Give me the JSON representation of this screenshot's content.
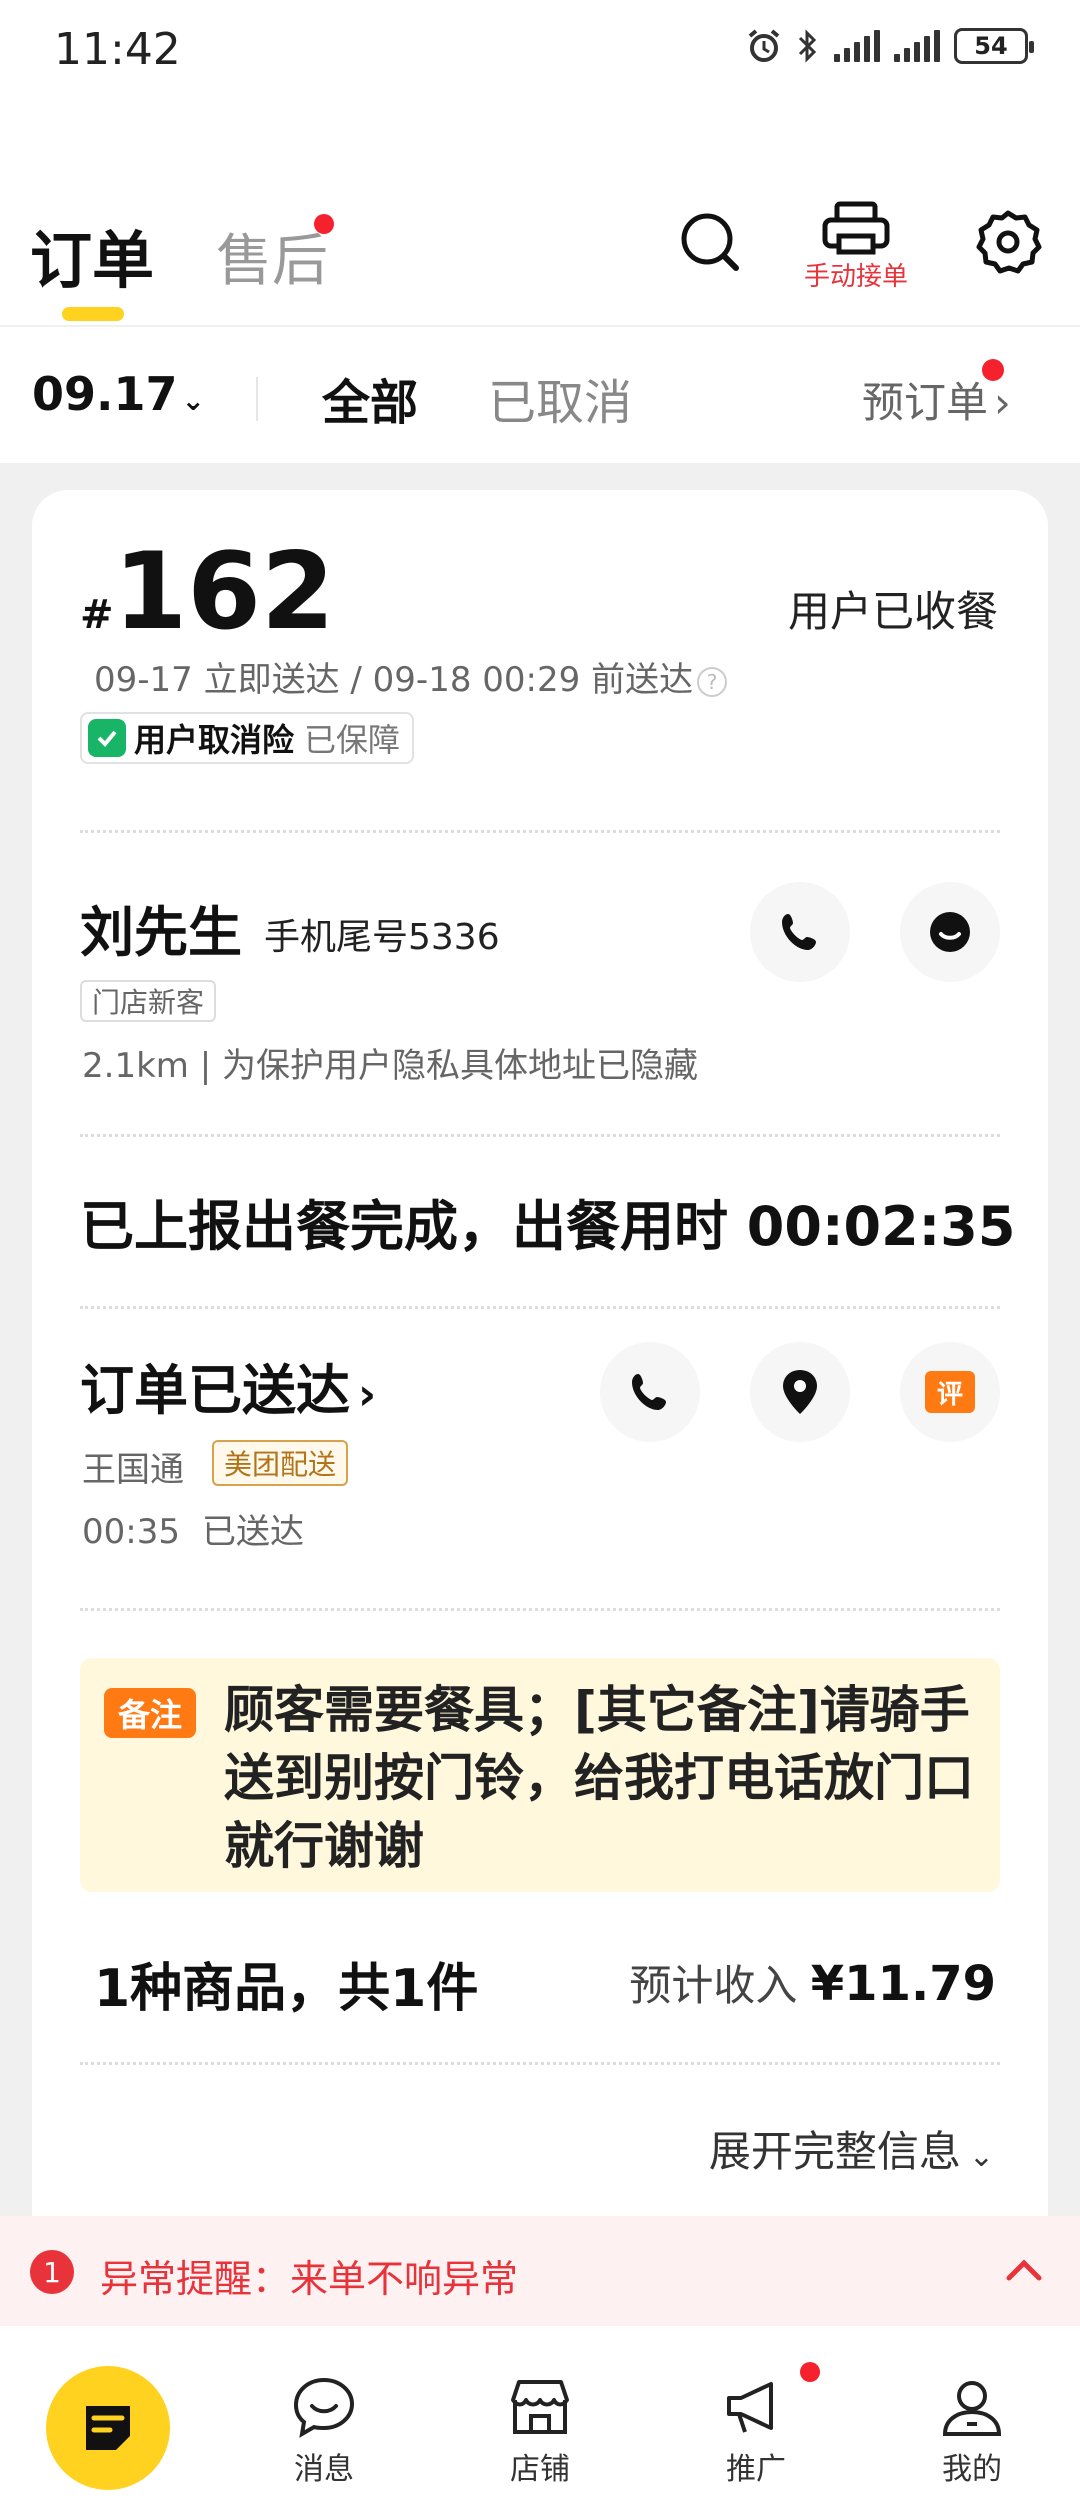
{
  "status_bar": {
    "time": "11:42",
    "battery": "54"
  },
  "header": {
    "tabs": [
      {
        "label": "订单"
      },
      {
        "label": "售后"
      }
    ],
    "manual_accept_label": "手动接单",
    "icons": [
      "search-icon",
      "printer-icon",
      "gear-icon"
    ]
  },
  "filters": {
    "date": "09.17",
    "options": [
      "全部",
      "已取消"
    ],
    "selected": "全部",
    "preorder_label": "预订单"
  },
  "order": {
    "hash": "#",
    "number": "162",
    "status": "用户已收餐",
    "time_info": "09-17 立即送达 / 09-18 00:29 前送达",
    "insurance_label": "用户取消险",
    "insurance_status": "已保障",
    "customer": {
      "name": "刘先生",
      "phone_tail": "手机尾号5336",
      "tag": "门店新客",
      "address": "2.1km | 为保护用户隐私具体地址已隐藏"
    },
    "cooking_status": "已上报出餐完成，出餐用时 00:02:35",
    "delivery": {
      "title": "订单已送达",
      "rider": "王国通",
      "carrier": "美团配送",
      "time": "00:35",
      "state": "已送达",
      "review_icon_text": "评"
    },
    "note": {
      "label": "备注",
      "text": "顾客需要餐具；[其它备注]请骑手送到别按门铃，给我打电话放门口就行谢谢"
    },
    "items_summary": "1种商品，共1件",
    "income_label": "预计收入",
    "income_value": "¥11.79",
    "expand_label": "展开完整信息"
  },
  "alert": {
    "count": "1",
    "text": "异常提醒：来单不响异常"
  },
  "bottom_nav": [
    {
      "label": "消息",
      "icon": "message-icon"
    },
    {
      "label": "店铺",
      "icon": "store-icon"
    },
    {
      "label": "推广",
      "icon": "megaphone-icon"
    },
    {
      "label": "我的",
      "icon": "profile-icon"
    }
  ],
  "colors": {
    "accent": "#ffd21f",
    "alert_red": "#e8333b",
    "note_bg": "#fff8dd",
    "note_label": "#ff7a13"
  }
}
